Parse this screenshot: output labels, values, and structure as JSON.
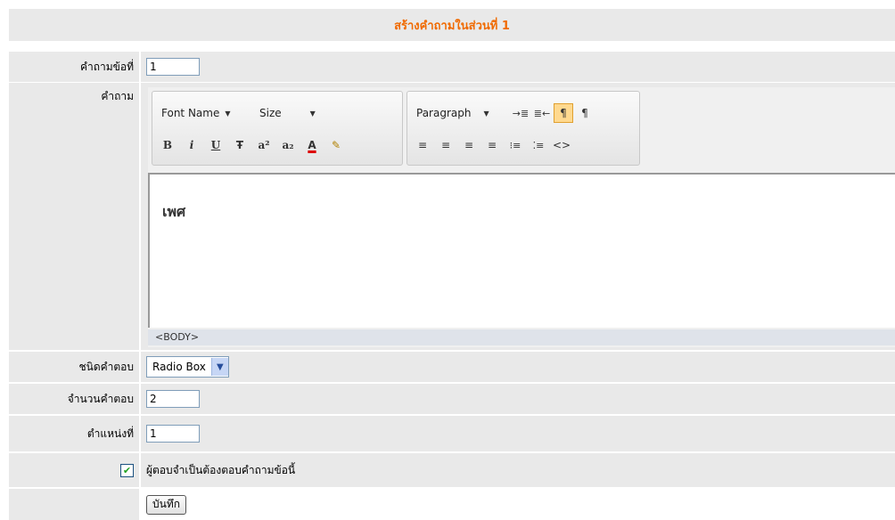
{
  "header": {
    "title": "สร้างคำถามในส่วนที่ 1"
  },
  "fields": {
    "question_no_label": "คำถามข้อที่",
    "question_no_value": "1",
    "question_label": "คำถาม",
    "answer_type_label": "ชนิดคำตอบ",
    "answer_type_value": "Radio Box",
    "answer_count_label": "จำนวนคำตอบ",
    "answer_count_value": "2",
    "position_label": "ตำแหน่งที่",
    "position_value": "1",
    "required_label": "ผู้ตอบจำเป็นต้องตอบคำถามข้อนี้",
    "required_checked": true,
    "save_label": "บันทึก"
  },
  "editor": {
    "font_name": "Font Name",
    "size": "Size",
    "paragraph": "Paragraph",
    "content": "เพศ",
    "status": "<BODY>",
    "toolbar_glyphs": {
      "bold": "B",
      "italic": "i",
      "underline": "U",
      "strike": "Ŧ",
      "superscript": "a²",
      "subscript": "a₂",
      "font_color": "A",
      "highlight": "✎",
      "indent": "→≣",
      "outdent": "≣←",
      "ltr": "¶",
      "rtl": "¶",
      "align_left": "≡",
      "align_center": "≡",
      "align_right": "≡",
      "justify": "≡",
      "ordered_list": "⁝≡",
      "unordered_list": "⁚≡",
      "source": "<>"
    }
  },
  "colors": {
    "title": "#f06a00",
    "row_bg": "#e9e9e9",
    "active_button": "#ffd98f"
  }
}
